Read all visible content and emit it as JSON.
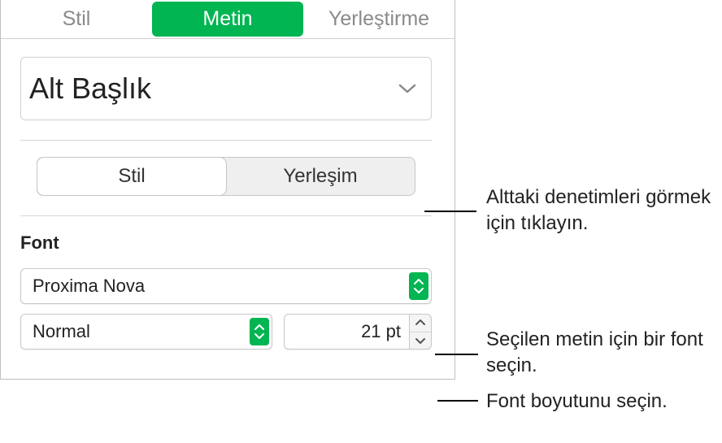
{
  "tabs": {
    "stil": "Stil",
    "metin": "Metin",
    "yerlestirme": "Yerleştirme"
  },
  "paragraph_style": {
    "value": "Alt Başlık"
  },
  "segmented": {
    "stil": "Stil",
    "yerlesim": "Yerleşim"
  },
  "font_section": {
    "heading": "Font",
    "family": "Proxima Nova",
    "weight": "Normal",
    "size": "21 pt"
  },
  "callouts": {
    "segmented": "Alttaki denetimleri görmek için tıklayın.",
    "family": "Seçilen metin için bir font seçin.",
    "size": "Font boyutunu seçin."
  }
}
